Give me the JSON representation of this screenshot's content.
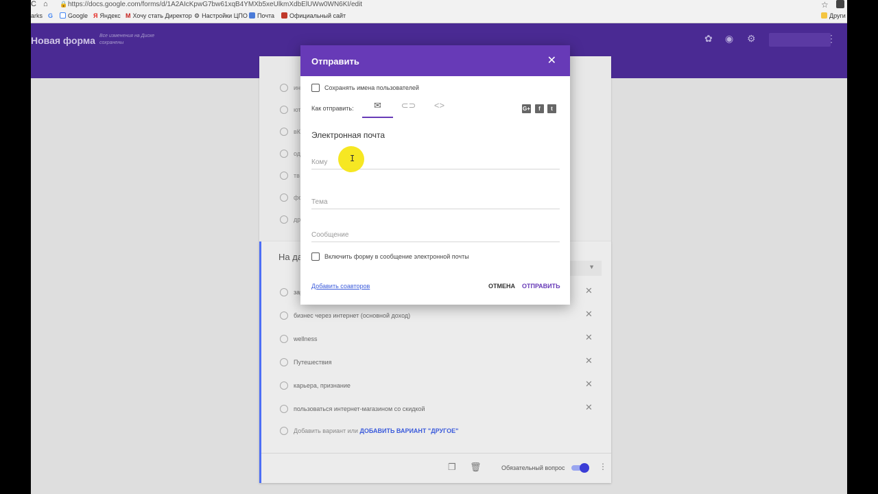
{
  "browser": {
    "url": "https://docs.google.com/forms/d/1A2AIcKpwG7bw61xqB4YMXb5xeUlkmXdbElUWw0WN6KI/edit",
    "bookmarks": [
      "arks",
      "G",
      "Google",
      "Яндекс",
      "Хочу стать Директор",
      "Настройки ЦПО",
      "Почта",
      "Официальный сайт",
      "Други"
    ]
  },
  "forms_header": {
    "title": "Новая форма",
    "saved_status": "Все изменения на Диске сохранены",
    "icons": [
      "palette-icon",
      "eye-icon",
      "gear-icon",
      "more-vert-icon"
    ]
  },
  "sheet_options": [
    "ин",
    "ют",
    "вК",
    "од",
    "тв",
    "фо",
    "дру"
  ],
  "question_card": {
    "question": "На да интер",
    "options": [
      "зар",
      "бизнес через интернет (основной доход)",
      "wellness",
      "Путешествия",
      "карьера, признание",
      "пользоваться интернет-магазином со скидкой"
    ],
    "add_option": "Добавить вариант",
    "or": "или",
    "add_other": "ДОБАВИТЬ ВАРИАНТ \"ДРУГОЕ\"",
    "required_label": "Обязательный вопрос",
    "required_on": true
  },
  "dialog": {
    "title": "Отправить",
    "save_usernames": "Сохранять имена пользователей",
    "how_to_send": "Как отправить:",
    "send_tabs": [
      {
        "icon": "email-icon",
        "active": true
      },
      {
        "icon": "link-icon",
        "active": false
      },
      {
        "icon": "embed-icon",
        "active": false
      }
    ],
    "social": [
      "G+",
      "f",
      "t"
    ],
    "section_title": "Электронная почта",
    "to_placeholder": "Кому",
    "subject_placeholder": "Тема",
    "message_placeholder": "Сообщение",
    "include_form": "Включить форму в сообщение электронной почты",
    "add_collaborators": "Добавить соавторов",
    "cancel": "ОТМЕНА",
    "send": "ОТПРАВИТЬ"
  }
}
